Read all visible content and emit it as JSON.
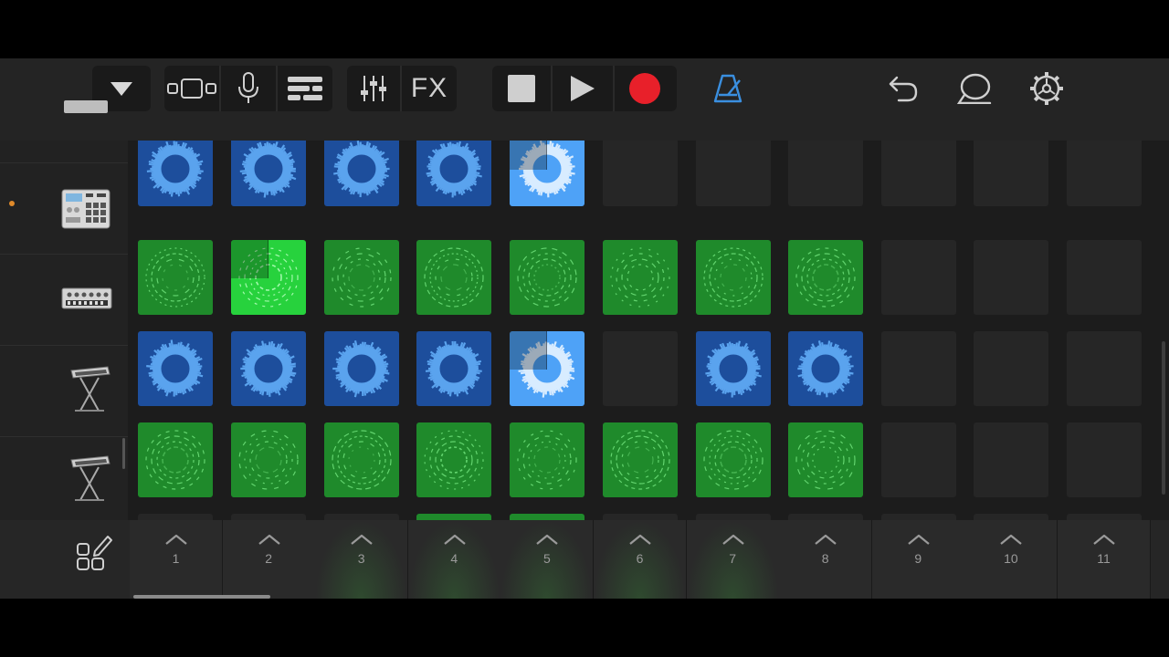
{
  "toolbar": {
    "buttons": [
      {
        "name": "tracks-menu-button",
        "icon": "triangle-down-icon"
      },
      {
        "name": "view-toggle-button",
        "icon": "track-view-icon"
      },
      {
        "name": "microphone-button",
        "icon": "microphone-icon"
      },
      {
        "name": "tracks-list-button",
        "icon": "tracks-list-icon"
      },
      {
        "name": "mixer-button",
        "icon": "sliders-icon"
      },
      {
        "name": "fx-button",
        "label": "FX"
      },
      {
        "name": "stop-button",
        "icon": "stop-icon"
      },
      {
        "name": "play-button",
        "icon": "play-icon"
      },
      {
        "name": "record-button",
        "icon": "record-icon",
        "color": "#e8202a"
      },
      {
        "name": "metronome-button",
        "icon": "metronome-icon",
        "color": "#3a8fe0"
      },
      {
        "name": "undo-button",
        "icon": "undo-icon"
      },
      {
        "name": "loop-browser-button",
        "icon": "lasso-icon"
      },
      {
        "name": "settings-button",
        "icon": "gear-icon"
      }
    ],
    "fx_label": "FX"
  },
  "tracks": [
    {
      "icon": "drum-machine-icon",
      "armed": false
    },
    {
      "icon": "drum-machine-icon",
      "armed": true
    },
    {
      "icon": "synth-module-icon",
      "armed": false
    },
    {
      "icon": "keyboard-stand-icon",
      "armed": false
    },
    {
      "icon": "keyboard-stand-icon",
      "armed": false
    }
  ],
  "grid_rows": [
    [
      "blue",
      "blue",
      "blue",
      "blue",
      "blue-bright",
      "empty",
      "empty",
      "empty",
      "empty",
      "empty",
      "empty"
    ],
    [
      "green",
      "green-bright",
      "green",
      "green",
      "green",
      "green",
      "green",
      "green",
      "empty",
      "empty",
      "empty"
    ],
    [
      "blue",
      "blue",
      "blue",
      "blue",
      "blue-bright",
      "empty",
      "blue",
      "blue",
      "empty",
      "empty",
      "empty"
    ],
    [
      "green",
      "green",
      "green",
      "green",
      "green",
      "green",
      "green",
      "green",
      "empty",
      "empty",
      "empty"
    ],
    [
      "empty",
      "empty",
      "empty",
      "green",
      "green",
      "empty",
      "empty",
      "empty",
      "empty",
      "empty",
      "empty"
    ]
  ],
  "scenes": [
    "1",
    "2",
    "3",
    "4",
    "5",
    "6",
    "7",
    "8",
    "9",
    "10",
    "11"
  ],
  "colors": {
    "green": "#1f8a2b",
    "green_bright": "#27d23d",
    "blue": "#1d4e9c",
    "blue_bright": "#4ea2f7",
    "record": "#e8202a",
    "accent": "#3a8fe0"
  }
}
